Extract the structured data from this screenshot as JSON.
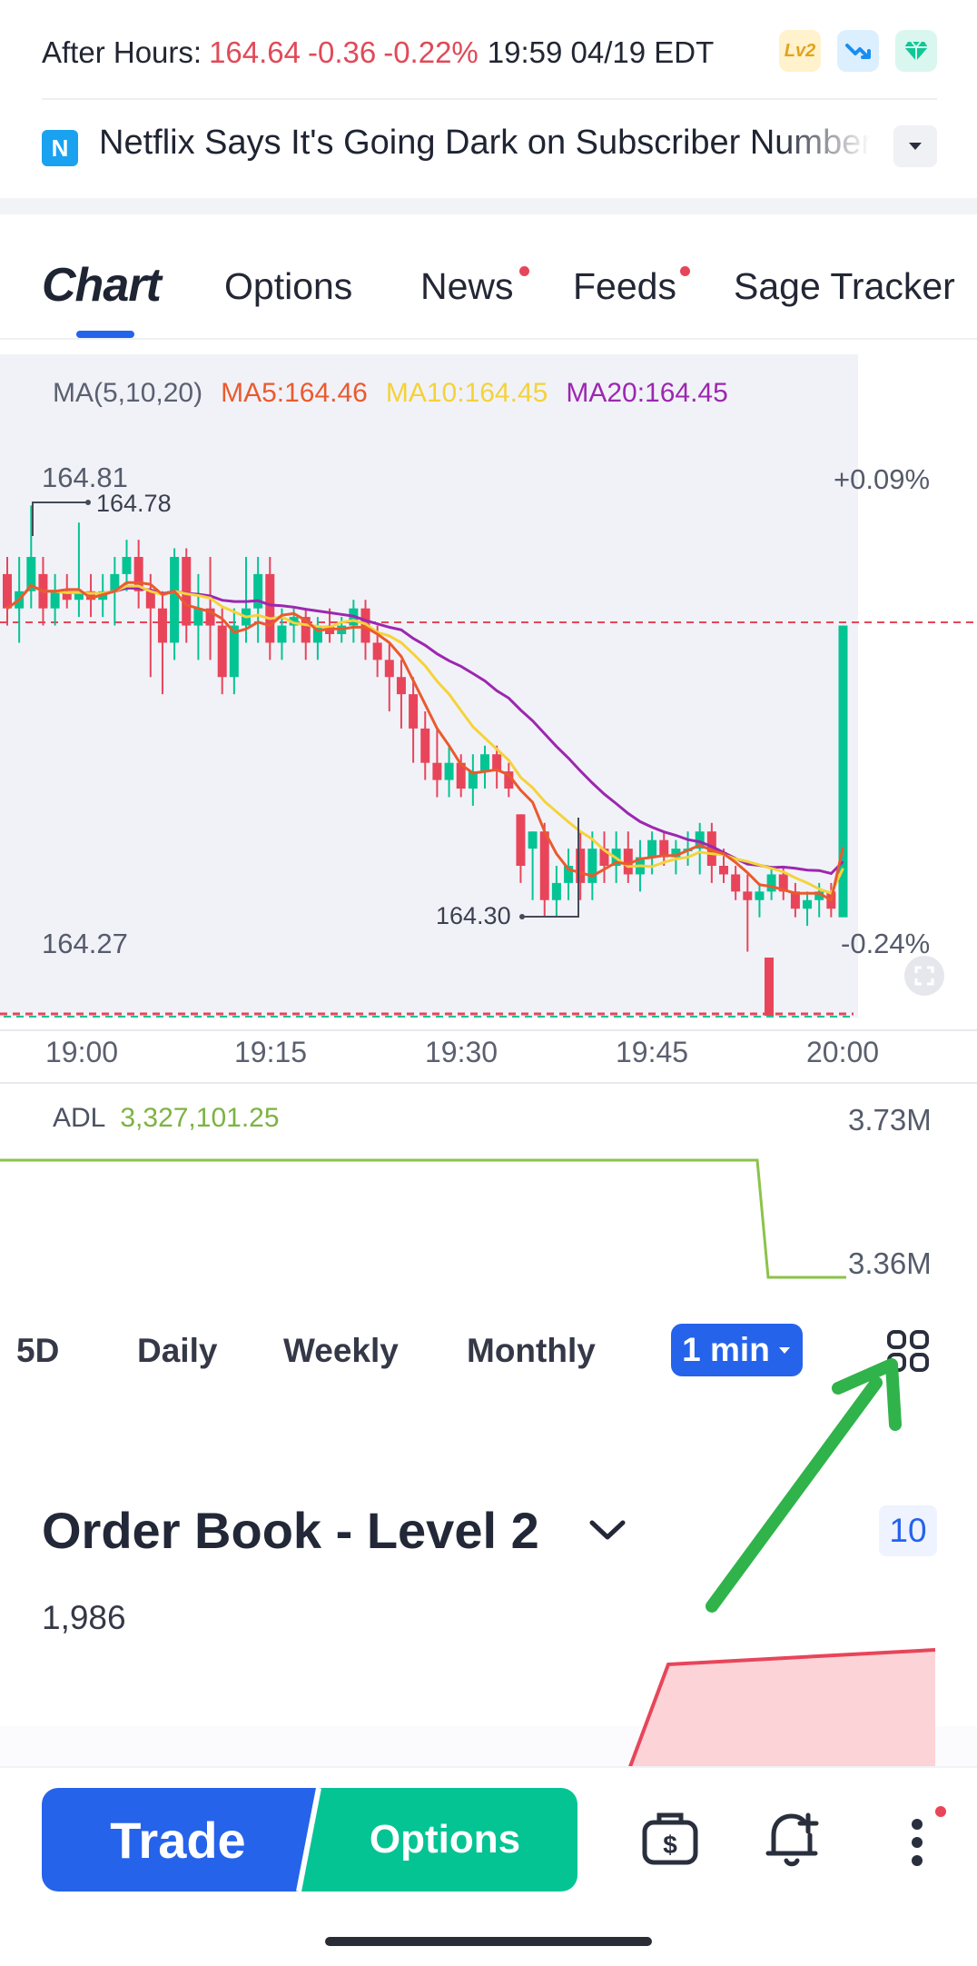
{
  "after_hours": {
    "label": "After Hours:",
    "price": "164.64",
    "change": "-0.36",
    "change_pct": "-0.22%",
    "time": "19:59 04/19 EDT",
    "badges": [
      "lv2-badge",
      "trend-down-icon",
      "diamond-icon"
    ],
    "lv2_text": "Lv2"
  },
  "news": {
    "icon_letter": "N",
    "headline": "Netflix Says It's Going Dark on Subscriber Numbers"
  },
  "tabs": {
    "chart": "Chart",
    "options": "Options",
    "news": "News",
    "feeds": "Feeds",
    "sage": "Sage Tracker"
  },
  "chart": {
    "ma_label": "MA(5,10,20)",
    "ma5": "MA5:164.46",
    "ma10": "MA10:164.45",
    "ma20": "MA20:164.45",
    "high_label": "164.81",
    "high_marker": "164.78",
    "low_label": "164.27",
    "low_marker": "164.30",
    "pct_top": "+0.09%",
    "pct_bottom": "-0.24%",
    "x_ticks": [
      "19:00",
      "19:15",
      "19:30",
      "19:45",
      "20:00"
    ],
    "colors": {
      "up": "#05c494",
      "down": "#e8455a",
      "ma5": "#ea5a2e",
      "ma10": "#f5d33a",
      "ma20": "#9c27b0"
    }
  },
  "adl": {
    "label": "ADL",
    "value": "3,327,101.25",
    "axis_top": "3.73M",
    "axis_bottom": "3.36M"
  },
  "periods": {
    "items": [
      "5D",
      "Daily",
      "Weekly",
      "Monthly"
    ],
    "active": "1 min"
  },
  "order_book": {
    "title": "Order Book - Level 2",
    "count": "10",
    "size": "1,986"
  },
  "bottom": {
    "trade": "Trade",
    "options": "Options"
  },
  "chart_data": {
    "type": "candlestick",
    "x_ticks": [
      "19:00",
      "19:15",
      "19:30",
      "19:45",
      "20:00"
    ],
    "y_labels": {
      "high": "164.81",
      "low": "164.27",
      "high_pct": "+0.09%",
      "low_pct": "-0.24%"
    },
    "annotations": {
      "max": "164.78",
      "min": "164.30"
    },
    "candles": [
      {
        "o": 164.7,
        "h": 164.72,
        "l": 164.64,
        "c": 164.66
      },
      {
        "o": 164.66,
        "h": 164.72,
        "l": 164.62,
        "c": 164.68
      },
      {
        "o": 164.68,
        "h": 164.78,
        "l": 164.66,
        "c": 164.72
      },
      {
        "o": 164.7,
        "h": 164.72,
        "l": 164.64,
        "c": 164.66
      },
      {
        "o": 164.66,
        "h": 164.7,
        "l": 164.64,
        "c": 164.68
      },
      {
        "o": 164.68,
        "h": 164.7,
        "l": 164.66,
        "c": 164.67
      },
      {
        "o": 164.67,
        "h": 164.76,
        "l": 164.65,
        "c": 164.68
      },
      {
        "o": 164.68,
        "h": 164.7,
        "l": 164.65,
        "c": 164.67
      },
      {
        "o": 164.67,
        "h": 164.7,
        "l": 164.65,
        "c": 164.68
      },
      {
        "o": 164.68,
        "h": 164.72,
        "l": 164.64,
        "c": 164.7
      },
      {
        "o": 164.7,
        "h": 164.74,
        "l": 164.68,
        "c": 164.72
      },
      {
        "o": 164.72,
        "h": 164.74,
        "l": 164.66,
        "c": 164.68
      },
      {
        "o": 164.68,
        "h": 164.7,
        "l": 164.58,
        "c": 164.66
      },
      {
        "o": 164.66,
        "h": 164.68,
        "l": 164.56,
        "c": 164.62
      },
      {
        "o": 164.62,
        "h": 164.73,
        "l": 164.6,
        "c": 164.72
      },
      {
        "o": 164.72,
        "h": 164.73,
        "l": 164.62,
        "c": 164.64
      },
      {
        "o": 164.64,
        "h": 164.7,
        "l": 164.6,
        "c": 164.66
      },
      {
        "o": 164.66,
        "h": 164.72,
        "l": 164.6,
        "c": 164.64
      },
      {
        "o": 164.64,
        "h": 164.66,
        "l": 164.56,
        "c": 164.58
      },
      {
        "o": 164.58,
        "h": 164.66,
        "l": 164.56,
        "c": 164.64
      },
      {
        "o": 164.64,
        "h": 164.72,
        "l": 164.62,
        "c": 164.66
      },
      {
        "o": 164.66,
        "h": 164.72,
        "l": 164.62,
        "c": 164.7
      },
      {
        "o": 164.7,
        "h": 164.72,
        "l": 164.6,
        "c": 164.62
      },
      {
        "o": 164.62,
        "h": 164.66,
        "l": 164.6,
        "c": 164.64
      },
      {
        "o": 164.64,
        "h": 164.66,
        "l": 164.62,
        "c": 164.65
      },
      {
        "o": 164.65,
        "h": 164.66,
        "l": 164.6,
        "c": 164.62
      },
      {
        "o": 164.62,
        "h": 164.65,
        "l": 164.6,
        "c": 164.64
      },
      {
        "o": 164.64,
        "h": 164.66,
        "l": 164.62,
        "c": 164.63
      },
      {
        "o": 164.63,
        "h": 164.65,
        "l": 164.62,
        "c": 164.64
      },
      {
        "o": 164.64,
        "h": 164.67,
        "l": 164.62,
        "c": 164.66
      },
      {
        "o": 164.66,
        "h": 164.67,
        "l": 164.6,
        "c": 164.62
      },
      {
        "o": 164.62,
        "h": 164.64,
        "l": 164.58,
        "c": 164.6
      },
      {
        "o": 164.6,
        "h": 164.62,
        "l": 164.54,
        "c": 164.58
      },
      {
        "o": 164.58,
        "h": 164.6,
        "l": 164.52,
        "c": 164.56
      },
      {
        "o": 164.56,
        "h": 164.58,
        "l": 164.48,
        "c": 164.52
      },
      {
        "o": 164.52,
        "h": 164.54,
        "l": 164.46,
        "c": 164.48
      },
      {
        "o": 164.48,
        "h": 164.52,
        "l": 164.44,
        "c": 164.46
      },
      {
        "o": 164.46,
        "h": 164.5,
        "l": 164.44,
        "c": 164.48
      },
      {
        "o": 164.48,
        "h": 164.49,
        "l": 164.44,
        "c": 164.45
      },
      {
        "o": 164.45,
        "h": 164.49,
        "l": 164.43,
        "c": 164.47
      },
      {
        "o": 164.47,
        "h": 164.5,
        "l": 164.45,
        "c": 164.49
      },
      {
        "o": 164.49,
        "h": 164.5,
        "l": 164.45,
        "c": 164.47
      },
      {
        "o": 164.47,
        "h": 164.48,
        "l": 164.44,
        "c": 164.45
      },
      {
        "o": 164.42,
        "h": 164.42,
        "l": 164.34,
        "c": 164.36
      },
      {
        "o": 164.38,
        "h": 164.4,
        "l": 164.32,
        "c": 164.4
      },
      {
        "o": 164.4,
        "h": 164.41,
        "l": 164.3,
        "c": 164.32
      },
      {
        "o": 164.32,
        "h": 164.36,
        "l": 164.3,
        "c": 164.34
      },
      {
        "o": 164.34,
        "h": 164.38,
        "l": 164.32,
        "c": 164.36
      },
      {
        "o": 164.38,
        "h": 164.4,
        "l": 164.32,
        "c": 164.34
      },
      {
        "o": 164.34,
        "h": 164.4,
        "l": 164.32,
        "c": 164.38
      },
      {
        "o": 164.38,
        "h": 164.4,
        "l": 164.34,
        "c": 164.36
      },
      {
        "o": 164.36,
        "h": 164.4,
        "l": 164.34,
        "c": 164.38
      },
      {
        "o": 164.38,
        "h": 164.4,
        "l": 164.34,
        "c": 164.35
      },
      {
        "o": 164.35,
        "h": 164.39,
        "l": 164.33,
        "c": 164.37
      },
      {
        "o": 164.37,
        "h": 164.4,
        "l": 164.35,
        "c": 164.39
      },
      {
        "o": 164.39,
        "h": 164.4,
        "l": 164.36,
        "c": 164.37
      },
      {
        "o": 164.37,
        "h": 164.39,
        "l": 164.35,
        "c": 164.38
      },
      {
        "o": 164.38,
        "h": 164.4,
        "l": 164.36,
        "c": 164.38
      },
      {
        "o": 164.38,
        "h": 164.41,
        "l": 164.35,
        "c": 164.4
      },
      {
        "o": 164.4,
        "h": 164.41,
        "l": 164.34,
        "c": 164.36
      },
      {
        "o": 164.36,
        "h": 164.38,
        "l": 164.34,
        "c": 164.35
      },
      {
        "o": 164.35,
        "h": 164.36,
        "l": 164.32,
        "c": 164.33
      },
      {
        "o": 164.33,
        "h": 164.35,
        "l": 164.26,
        "c": 164.32
      },
      {
        "o": 164.32,
        "h": 164.34,
        "l": 164.3,
        "c": 164.33
      },
      {
        "o": 164.33,
        "h": 164.36,
        "l": 164.32,
        "c": 164.35
      },
      {
        "o": 164.35,
        "h": 164.36,
        "l": 164.32,
        "c": 164.33
      },
      {
        "o": 164.33,
        "h": 164.34,
        "l": 164.3,
        "c": 164.31
      },
      {
        "o": 164.31,
        "h": 164.33,
        "l": 164.29,
        "c": 164.32
      },
      {
        "o": 164.32,
        "h": 164.34,
        "l": 164.3,
        "c": 164.33
      },
      {
        "o": 164.33,
        "h": 164.34,
        "l": 164.3,
        "c": 164.31
      },
      {
        "o": 164.3,
        "h": 164.64,
        "l": 164.3,
        "c": 164.64
      }
    ],
    "ma_series": [
      {
        "name": "MA5",
        "value": "164.46"
      },
      {
        "name": "MA10",
        "value": "164.45"
      },
      {
        "name": "MA20",
        "value": "164.45"
      }
    ],
    "adl": {
      "type": "line",
      "top": "3.73M",
      "bottom": "3.36M",
      "value": "3,327,101.25"
    }
  }
}
